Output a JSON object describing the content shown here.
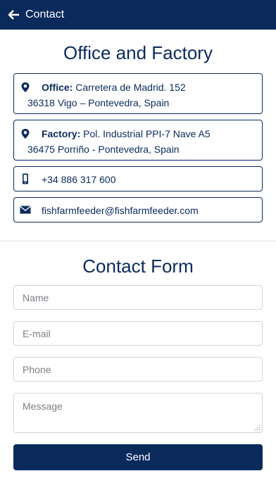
{
  "header": {
    "title": "Contact",
    "back_icon": "arrow-left-icon"
  },
  "office_section": {
    "title": "Office and Factory",
    "office": {
      "label": "Office:",
      "line1": "Carretera de Madrid. 152",
      "line2": "36318 Vigo – Pontevedra, Spain",
      "icon": "map-marker-icon"
    },
    "factory": {
      "label": "Factory:",
      "line1": "Pol. Industrial PPI-7 Nave A5",
      "line2": "36475 Porriño - Pontevedra, Spain",
      "icon": "map-marker-icon"
    },
    "phone": {
      "value": "+34 886 317 600",
      "icon": "mobile-phone-icon"
    },
    "email": {
      "value": "fishfarmfeeder@fishfarmfeeder.com",
      "icon": "envelope-icon"
    }
  },
  "form": {
    "title": "Contact Form",
    "name_placeholder": "Name",
    "email_placeholder": "E-mail",
    "phone_placeholder": "Phone",
    "message_placeholder": "Message",
    "submit_label": "Send"
  },
  "colors": {
    "primary": "#0a2a5c",
    "background": "#ffffff",
    "field_border": "#cfd4da",
    "placeholder": "#7b8085"
  }
}
